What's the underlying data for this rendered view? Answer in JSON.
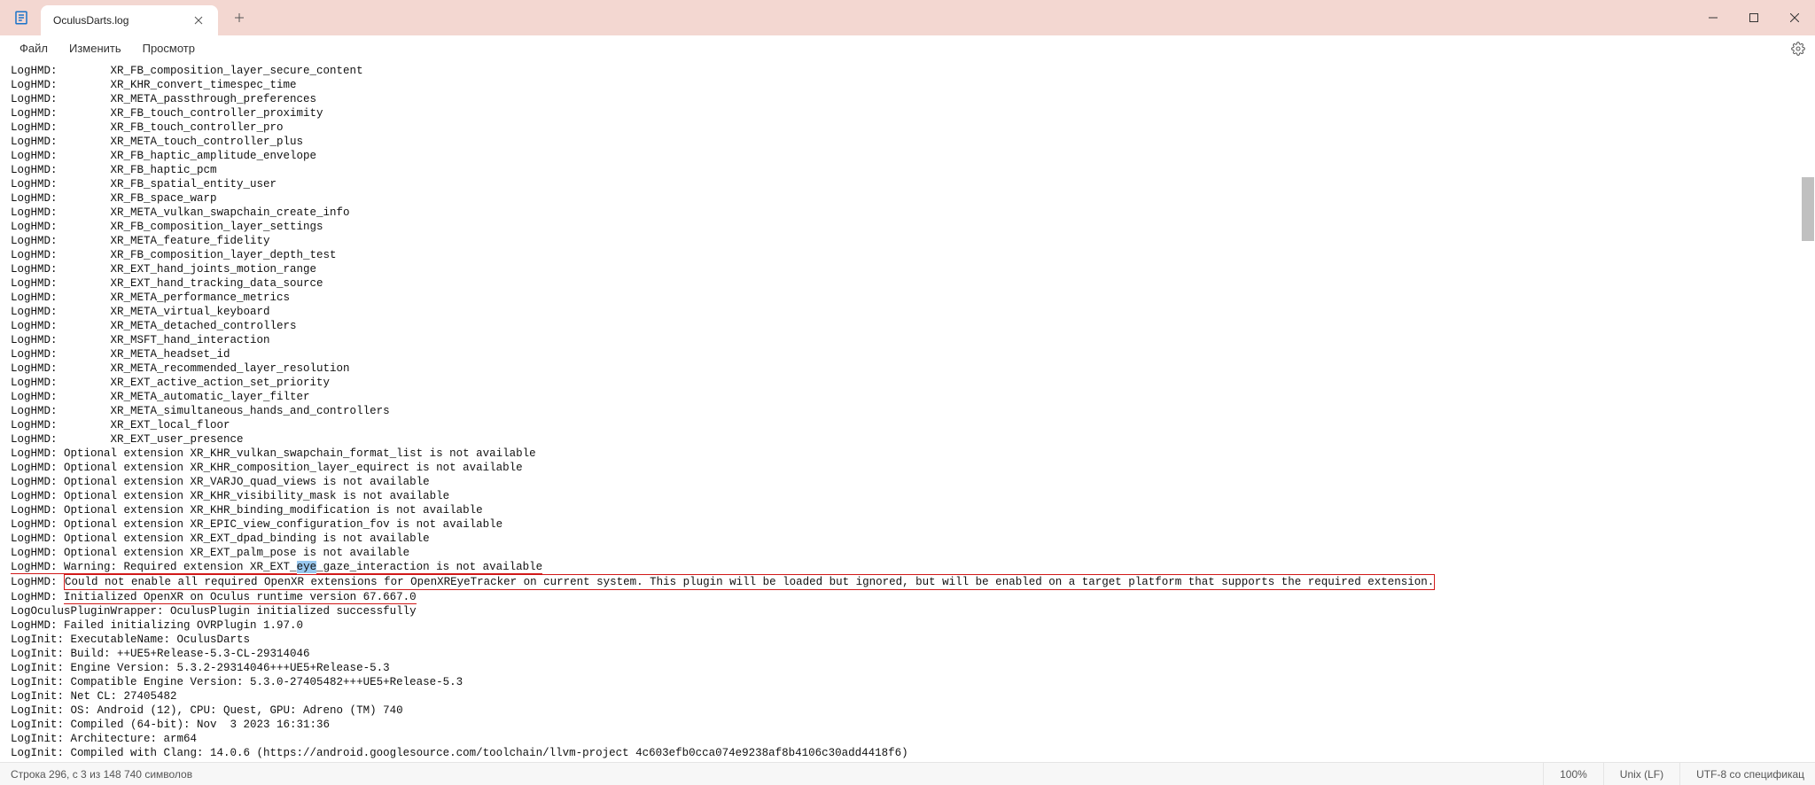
{
  "window": {
    "tab_title": "OculusDarts.log"
  },
  "menu": {
    "file": "Файл",
    "edit": "Изменить",
    "view": "Просмотр"
  },
  "log": {
    "prefix": "LogHMD:",
    "prefix_ocw": "LogOculusPluginWrapper:",
    "prefix_init": "LogInit:",
    "ext": [
      "XR_FB_composition_layer_secure_content",
      "XR_KHR_convert_timespec_time",
      "XR_META_passthrough_preferences",
      "XR_FB_touch_controller_proximity",
      "XR_FB_touch_controller_pro",
      "XR_META_touch_controller_plus",
      "XR_FB_haptic_amplitude_envelope",
      "XR_FB_haptic_pcm",
      "XR_FB_spatial_entity_user",
      "XR_FB_space_warp",
      "XR_META_vulkan_swapchain_create_info",
      "XR_FB_composition_layer_settings",
      "XR_META_feature_fidelity",
      "XR_FB_composition_layer_depth_test",
      "XR_EXT_hand_joints_motion_range",
      "XR_EXT_hand_tracking_data_source",
      "XR_META_performance_metrics",
      "XR_META_virtual_keyboard",
      "XR_META_detached_controllers",
      "XR_MSFT_hand_interaction",
      "XR_META_headset_id",
      "XR_META_recommended_layer_resolution",
      "XR_EXT_active_action_set_priority",
      "XR_META_automatic_layer_filter",
      "XR_META_simultaneous_hands_and_controllers",
      "XR_EXT_local_floor",
      "XR_EXT_user_presence"
    ],
    "opt": [
      "Optional extension XR_KHR_vulkan_swapchain_format_list is not available",
      "Optional extension XR_KHR_composition_layer_equirect is not available",
      "Optional extension XR_VARJO_quad_views is not available",
      "Optional extension XR_KHR_visibility_mask is not available",
      "Optional extension XR_KHR_binding_modification is not available",
      "Optional extension XR_EPIC_view_configuration_fov is not available",
      "Optional extension XR_EXT_dpad_binding is not available",
      "Optional extension XR_EXT_palm_pose is not available"
    ],
    "warn_pre": "Warning: Required extension XR_EXT_",
    "warn_sel": "eye",
    "warn_post": "_gaze_interaction is not available",
    "err_main": "Could not enable all required OpenXR extensions for OpenXREyeTracker on current system. This plugin will be loaded but ignored, but will be enabled on a target platform that supports the required extension.",
    "init_xr": "Initialized OpenXR on Oculus runtime version 67.667.0",
    "ocw_ok": "OculusPlugin initialized successfully",
    "ovr_fail": "Failed initializing OVRPlugin 1.97.0",
    "init_lines": [
      "ExecutableName: OculusDarts",
      "Build: ++UE5+Release-5.3-CL-29314046",
      "Engine Version: 5.3.2-29314046+++UE5+Release-5.3",
      "Compatible Engine Version: 5.3.0-27405482+++UE5+Release-5.3",
      "Net CL: 27405482",
      "OS: Android (12), CPU: Quest, GPU: Adreno (TM) 740",
      "Compiled (64-bit): Nov  3 2023 16:31:36",
      "Architecture: arm64",
      "Compiled with Clang: 14.0.6 (https://android.googlesource.com/toolchain/llvm-project 4c603efb0cca074e9238af8b4106c30add4418f6)"
    ]
  },
  "status": {
    "pos": "Строка 296, с    3 из 148 740 символов",
    "zoom": "100%",
    "eol": "Unix (LF)",
    "enc": "UTF-8 со спецификац"
  }
}
